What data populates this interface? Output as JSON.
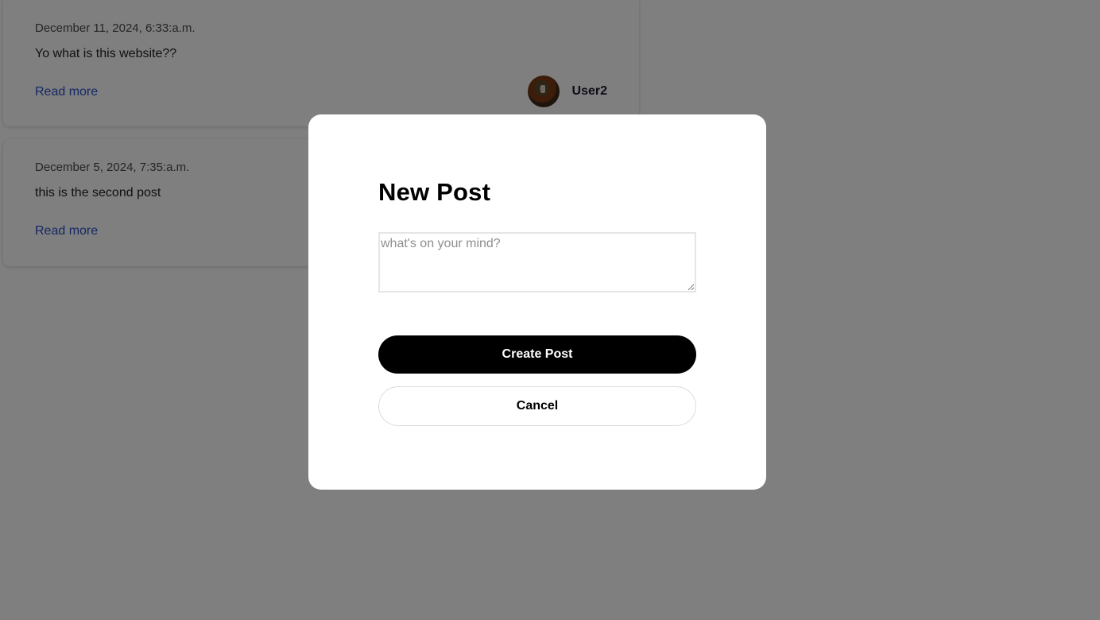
{
  "feed": {
    "posts": [
      {
        "date": "December 11, 2024, 6:33:a.m.",
        "text": "Yo what is this website??",
        "read_more": "Read more",
        "author": "User2"
      },
      {
        "date": "December 5, 2024, 7:35:a.m.",
        "text": "this is the second post",
        "read_more": "Read more"
      }
    ]
  },
  "modal": {
    "title": "New Post",
    "textarea": {
      "placeholder": "what's on your mind?",
      "value": ""
    },
    "create_label": "Create Post",
    "cancel_label": "Cancel"
  },
  "colors": {
    "overlay": "rgba(0,0,0,0.5)",
    "primary_button": "#000000",
    "link": "#2b50c8"
  }
}
